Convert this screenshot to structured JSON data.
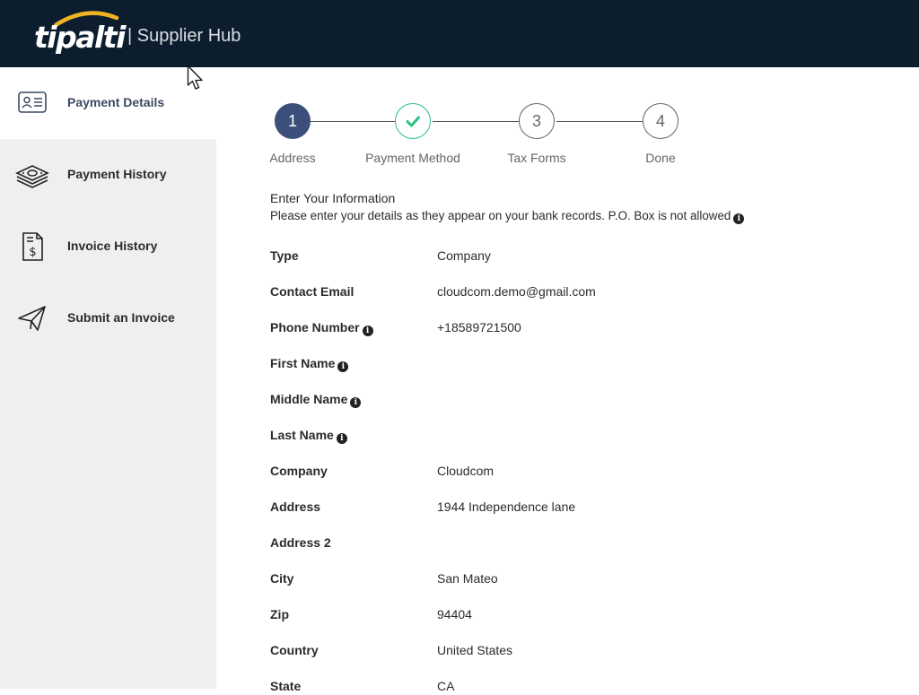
{
  "header": {
    "logo_text": "tipalti",
    "title": "| Supplier Hub",
    "background": "#0c1e2e",
    "logo_arc_color": "#f0b323"
  },
  "sidebar": {
    "items": [
      {
        "label": "Payment Details",
        "icon": "id-card-icon",
        "active": true
      },
      {
        "label": "Payment History",
        "icon": "money-stack-icon",
        "active": false
      },
      {
        "label": "Invoice History",
        "icon": "invoice-dollar-icon",
        "active": false
      },
      {
        "label": "Submit an Invoice",
        "icon": "paper-plane-icon",
        "active": false
      }
    ]
  },
  "stepper": {
    "steps": [
      {
        "number": "1",
        "label": "Address",
        "state": "current"
      },
      {
        "number": "",
        "label": "Payment Method",
        "state": "done"
      },
      {
        "number": "3",
        "label": "Tax Forms",
        "state": "pending"
      },
      {
        "number": "4",
        "label": "Done",
        "state": "pending"
      }
    ],
    "current_color": "#3c4f7a",
    "done_color": "#2bbf82"
  },
  "intro": {
    "title": "Enter Your Information",
    "note": "Please enter your details as they appear on your bank records. P.O. Box is not allowed"
  },
  "form": {
    "rows": [
      {
        "label": "Type",
        "value": "Company",
        "info": false
      },
      {
        "label": "Contact Email",
        "value": "cloudcom.demo@gmail.com",
        "info": false
      },
      {
        "label": "Phone Number",
        "value": "+18589721500",
        "info": true
      },
      {
        "label": "First Name",
        "value": "",
        "info": true
      },
      {
        "label": "Middle Name",
        "value": "",
        "info": true
      },
      {
        "label": "Last Name",
        "value": "",
        "info": true
      },
      {
        "label": "Company",
        "value": "Cloudcom",
        "info": false
      },
      {
        "label": "Address",
        "value": "1944 Independence lane",
        "info": false
      },
      {
        "label": "Address 2",
        "value": "",
        "info": false
      },
      {
        "label": "City",
        "value": "San Mateo",
        "info": false
      },
      {
        "label": "Zip",
        "value": "94404",
        "info": false
      },
      {
        "label": "Country",
        "value": "United States",
        "info": false
      },
      {
        "label": "State",
        "value": "CA",
        "info": false
      }
    ]
  }
}
